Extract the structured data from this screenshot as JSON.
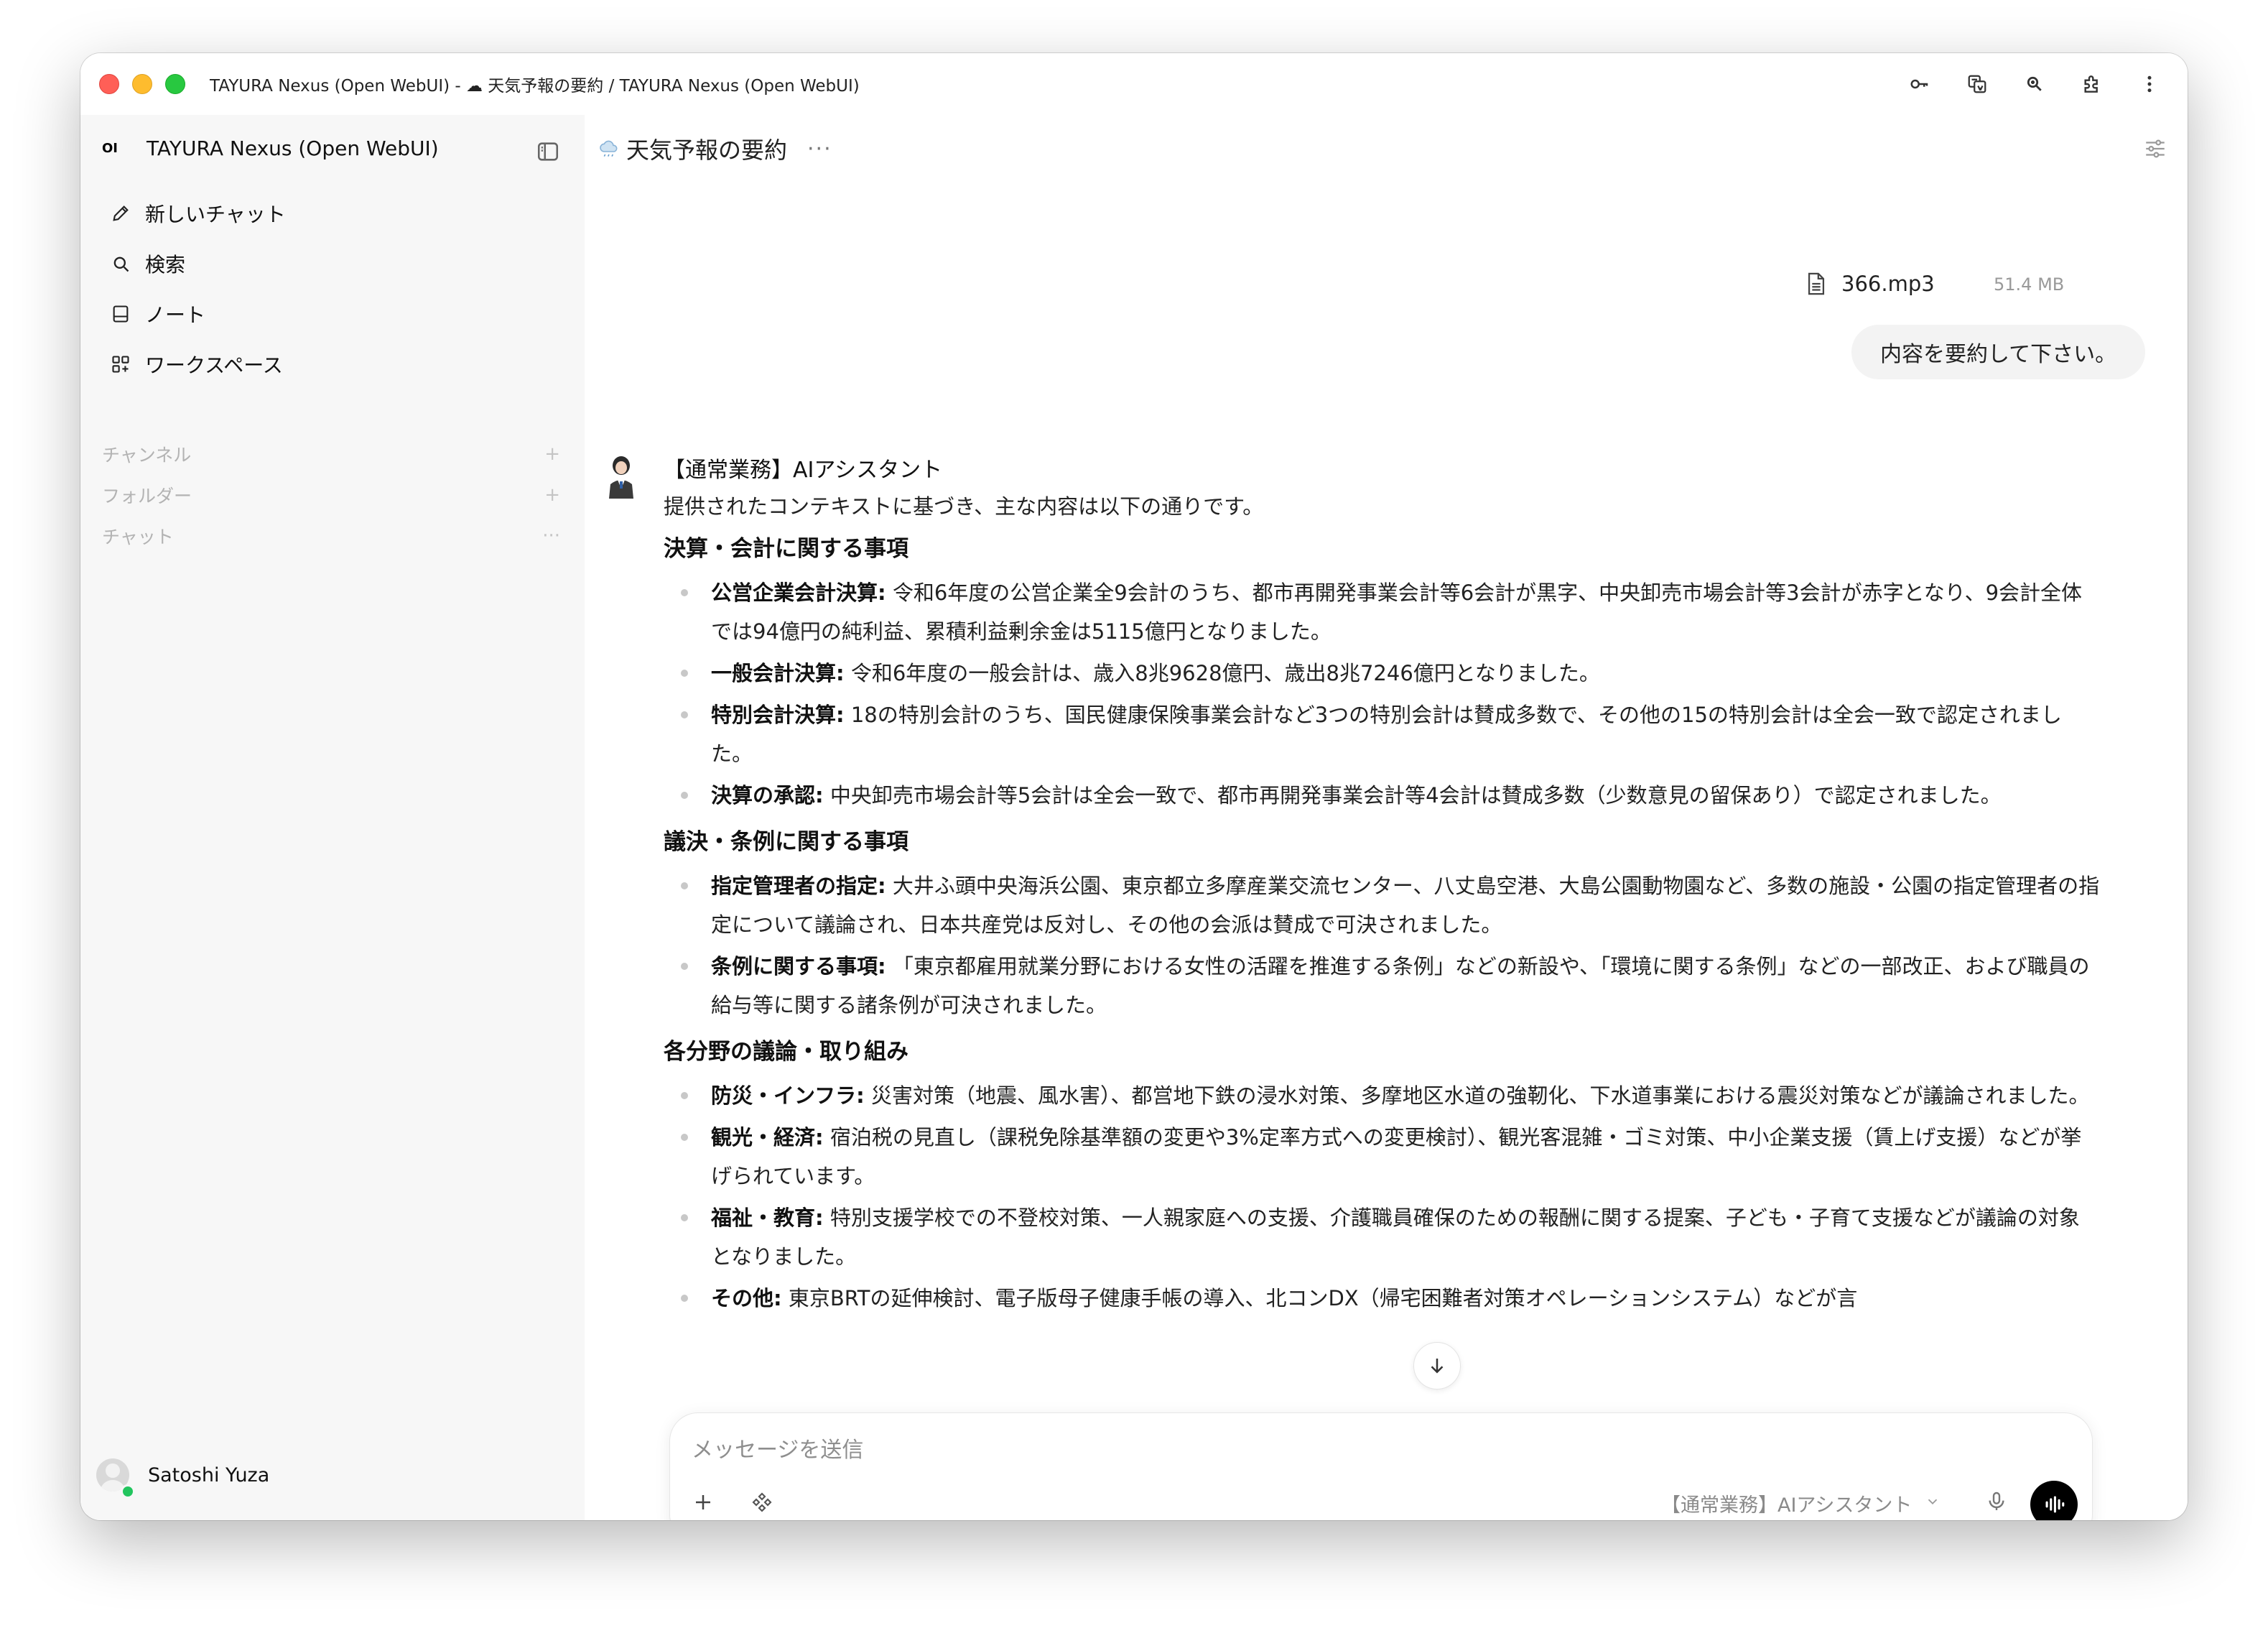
{
  "window": {
    "title": "TAYURA Nexus (Open WebUI) - ☁ 天気予報の要約 / TAYURA Nexus (Open WebUI)",
    "toolbar_icons": [
      "key-icon",
      "translate-icon",
      "zoom-icon",
      "extensions-icon",
      "more-vertical-icon"
    ]
  },
  "sidebar": {
    "logo": "OI",
    "brand": "TAYURA Nexus (Open WebUI)",
    "items": [
      {
        "label": "新しいチャット",
        "icon": "pencil-icon"
      },
      {
        "label": "検索",
        "icon": "search-icon"
      },
      {
        "label": "ノート",
        "icon": "note-icon"
      },
      {
        "label": "ワークスペース",
        "icon": "workspace-icon"
      }
    ],
    "sections": [
      {
        "label": "チャンネル",
        "action": "+"
      },
      {
        "label": "フォルダー",
        "action": "+"
      },
      {
        "label": "チャット",
        "action": "···"
      }
    ],
    "user": "Satoshi Yuza"
  },
  "header": {
    "title": "天気予報の要約",
    "more": "···"
  },
  "user_message": {
    "file_name": "366.mp3",
    "file_size": "51.4 MB",
    "text": "内容を要約して下さい。"
  },
  "assistant": {
    "name": "【通常業務】AIアシスタント",
    "intro": "提供されたコンテキストに基づき、主な内容は以下の通りです。",
    "sections": [
      {
        "heading": "決算・会計に関する事項",
        "bullets": [
          {
            "bold": "公営企業会計決算:",
            "text": " 令和6年度の公営企業全9会計のうち、都市再開発事業会計等6会計が黒字、中央卸売市場会計等3会計が赤字となり、9会計全体では94億円の純利益、累積利益剰余金は5115億円となりました。"
          },
          {
            "bold": "一般会計決算:",
            "text": " 令和6年度の一般会計は、歳入8兆9628億円、歳出8兆7246億円となりました。"
          },
          {
            "bold": "特別会計決算:",
            "text": " 18の特別会計のうち、国民健康保険事業会計など3つの特別会計は賛成多数で、その他の15の特別会計は全会一致で認定されました。"
          },
          {
            "bold": "決算の承認:",
            "text": " 中央卸売市場会計等5会計は全会一致で、都市再開発事業会計等4会計は賛成多数（少数意見の留保あり）で認定されました。"
          }
        ]
      },
      {
        "heading": "議決・条例に関する事項",
        "bullets": [
          {
            "bold": "指定管理者の指定:",
            "text": " 大井ふ頭中央海浜公園、東京都立多摩産業交流センター、八丈島空港、大島公園動物園など、多数の施設・公園の指定管理者の指定について議論され、日本共産党は反対し、その他の会派は賛成で可決されました。"
          },
          {
            "bold": "条例に関する事項:",
            "text": " 「東京都雇用就業分野における女性の活躍を推進する条例」などの新設や、「環境に関する条例」などの一部改正、および職員の給与等に関する諸条例が可決されました。"
          }
        ]
      },
      {
        "heading": "各分野の議論・取り組み",
        "bullets": [
          {
            "bold": "防災・インフラ:",
            "text": " 災害対策（地震、風水害）、都営地下鉄の浸水対策、多摩地区水道の強靭化、下水道事業における震災対策などが議論されました。"
          },
          {
            "bold": "観光・経済:",
            "text": " 宿泊税の見直し（課税免除基準額の変更や3%定率方式への変更検討）、観光客混雑・ゴミ対策、中小企業支援（賃上げ支援）などが挙げられています。"
          },
          {
            "bold": "福祉・教育:",
            "text": " 特別支援学校での不登校対策、一人親家庭への支援、介護職員確保のための報酬に関する提案、子ども・子育て支援などが議論の対象となりました。"
          },
          {
            "bold": "その他:",
            "text": " 東京BRTの延伸検討、電子版母子健康手帳の導入、北コンDX（帰宅困難者対策オペレーションシステム）などが言"
          }
        ]
      }
    ]
  },
  "composer": {
    "placeholder": "メッセージを送信",
    "model": "【通常業務】AIアシスタント"
  }
}
